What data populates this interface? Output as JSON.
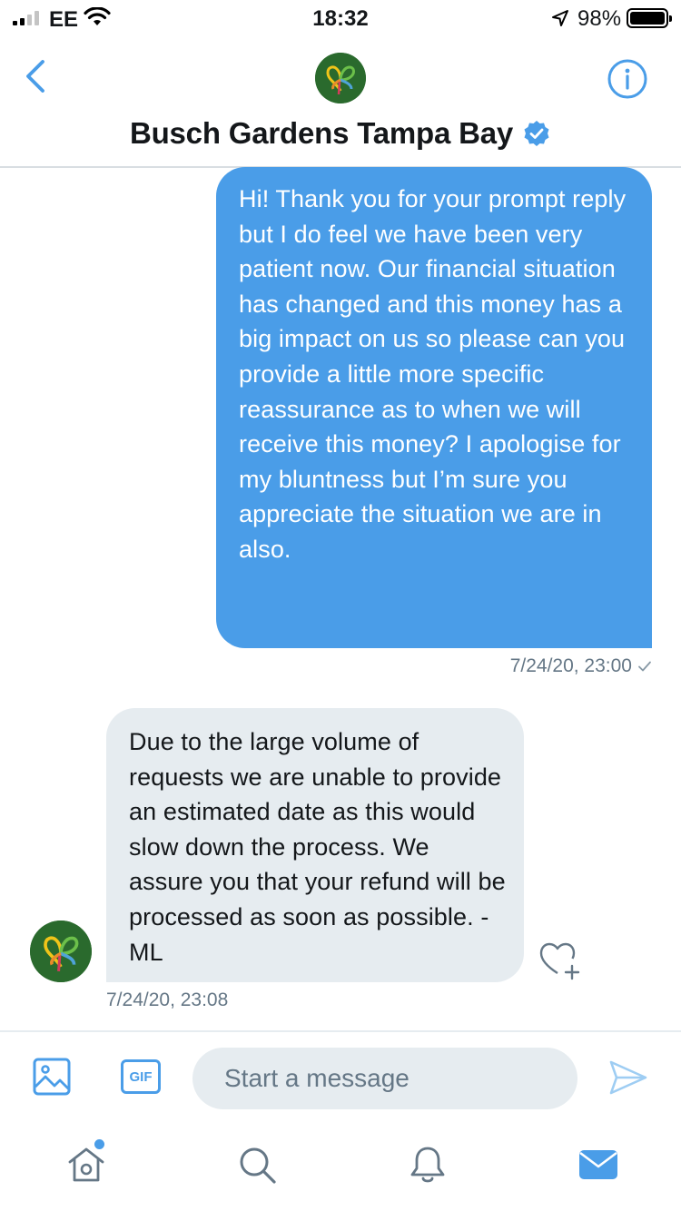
{
  "status_bar": {
    "carrier": "EE",
    "time": "18:32",
    "battery": "98%"
  },
  "header": {
    "title": "Busch Gardens Tampa Bay",
    "verified": true
  },
  "messages": [
    {
      "direction": "outgoing",
      "text": "Hi! Thank you for your prompt reply but I do feel we have been very patient now. Our financial situation has changed and this money has a big impact on us so please can you provide a little more specific reassurance as to when we will receive this money? I apologise for my bluntness but I’m sure you appreciate the situation we are in also.",
      "timestamp": "7/24/20, 23:00"
    },
    {
      "direction": "incoming",
      "text": "Due to the large volume of requests we are unable to provide an estimated date as this would slow down the process. We assure you that your refund will be processed as soon as possible. -ML",
      "timestamp": "7/24/20, 23:08"
    }
  ],
  "composer": {
    "gif_label": "GIF",
    "placeholder": "Start a message"
  },
  "colors": {
    "accent": "#4a9de8",
    "incoming_bubble": "#e6ecf0",
    "timestamp": "#657786"
  },
  "icons": [
    "back-arrow-icon",
    "info-icon",
    "verified-badge-icon",
    "image-icon",
    "send-icon",
    "like-icon",
    "home-icon",
    "search-icon",
    "bell-icon",
    "mail-icon"
  ]
}
